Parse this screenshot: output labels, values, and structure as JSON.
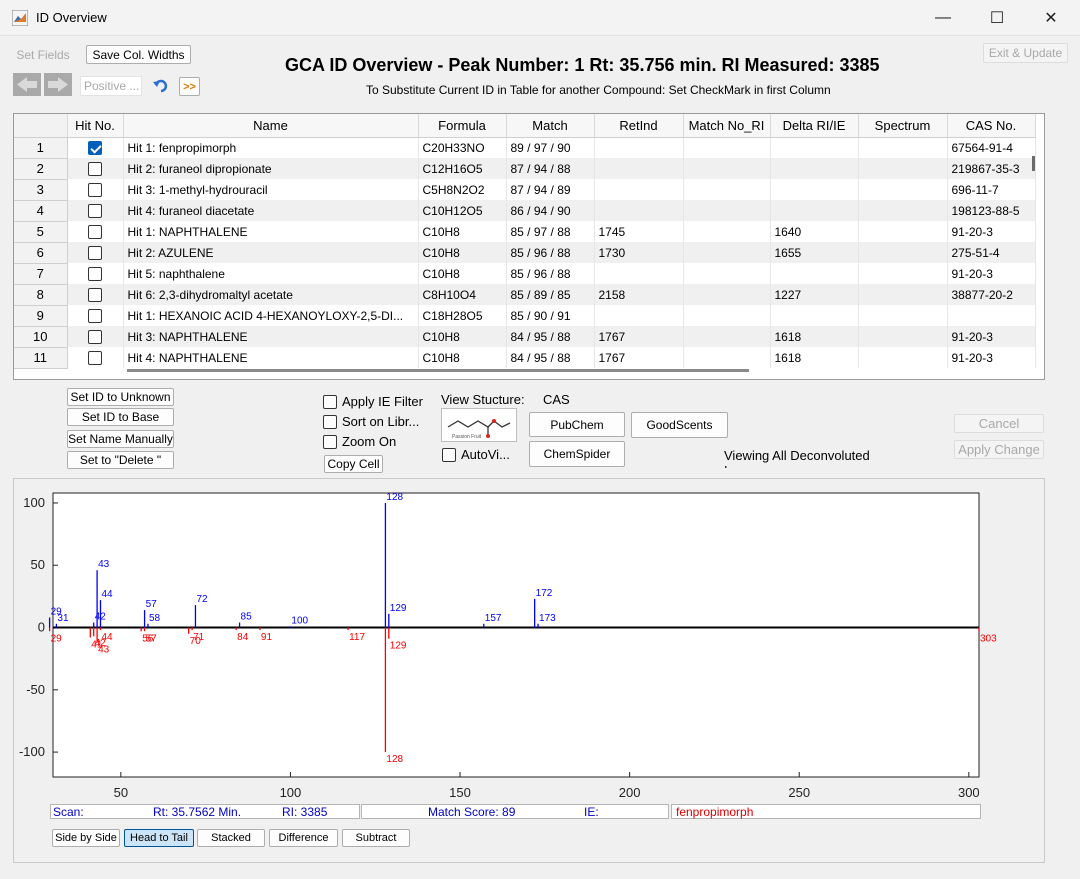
{
  "window": {
    "title": "ID Overview",
    "minimize": "—",
    "maximize": "☐",
    "close": "✕"
  },
  "toolbar": {
    "set_fields": "Set Fields",
    "save_col_widths": "Save Col. Widths",
    "mode_field": "Positive ...",
    "forward_label": ">>",
    "exit_update": "Exit & Update"
  },
  "header": {
    "title": "GCA ID Overview - Peak Number: 1  Rt: 35.756 min.  RI Measured: 3385",
    "subtitle": "To Substitute Current ID in Table for another Compound: Set CheckMark in first Column"
  },
  "table": {
    "columns": [
      "",
      "Hit No.",
      "Name",
      "Formula",
      "Match",
      "RetInd",
      "Match No_RI",
      "Delta RI/IE",
      "Spectrum",
      "CAS No."
    ],
    "rows": [
      {
        "num": "1",
        "checked": true,
        "name": "Hit  1: fenpropimorph",
        "formula": "C20H33NO",
        "match": "89 / 97 / 90",
        "retind": "",
        "matchnori": "",
        "delta": "",
        "spectrum": "",
        "cas": "67564-91-4"
      },
      {
        "num": "2",
        "checked": false,
        "name": "Hit  2: furaneol dipropionate",
        "formula": "C12H16O5",
        "match": "87 / 94 / 88",
        "retind": "",
        "matchnori": "",
        "delta": "",
        "spectrum": "",
        "cas": "219867-35-3"
      },
      {
        "num": "3",
        "checked": false,
        "name": "Hit  3: 1-methyl-hydrouracil",
        "formula": "C5H8N2O2",
        "match": "87 / 94 / 89",
        "retind": "",
        "matchnori": "",
        "delta": "",
        "spectrum": "",
        "cas": "696-11-7"
      },
      {
        "num": "4",
        "checked": false,
        "name": "Hit  4: furaneol diacetate",
        "formula": "C10H12O5",
        "match": "86 / 94 / 90",
        "retind": "",
        "matchnori": "",
        "delta": "",
        "spectrum": "",
        "cas": "198123-88-5"
      },
      {
        "num": "5",
        "checked": false,
        "name": "Hit  1: NAPHTHALENE",
        "formula": "C10H8",
        "match": "85 / 97 / 88",
        "retind": "1745",
        "matchnori": "",
        "delta": "1640",
        "spectrum": "",
        "cas": "91-20-3"
      },
      {
        "num": "6",
        "checked": false,
        "name": "Hit  2: AZULENE",
        "formula": "C10H8",
        "match": "85 / 96 / 88",
        "retind": "1730",
        "matchnori": "",
        "delta": "1655",
        "spectrum": "",
        "cas": "275-51-4"
      },
      {
        "num": "7",
        "checked": false,
        "name": "Hit  5: naphthalene",
        "formula": "C10H8",
        "match": "85 / 96 / 88",
        "retind": "",
        "matchnori": "",
        "delta": "",
        "spectrum": "",
        "cas": "91-20-3"
      },
      {
        "num": "8",
        "checked": false,
        "name": "Hit  6: 2,3-dihydromaltyl acetate",
        "formula": "C8H10O4",
        "match": "85 / 89 / 85",
        "retind": "2158",
        "matchnori": "",
        "delta": "1227",
        "spectrum": "",
        "cas": "38877-20-2"
      },
      {
        "num": "9",
        "checked": false,
        "name": "Hit  1: HEXANOIC ACID 4-HEXANOYLOXY-2,5-DI...",
        "formula": "C18H28O5",
        "match": "85 / 90 / 91",
        "retind": "",
        "matchnori": "",
        "delta": "",
        "spectrum": "",
        "cas": ""
      },
      {
        "num": "10",
        "checked": false,
        "name": "Hit  3: NAPHTHALENE",
        "formula": "C10H8",
        "match": "84 / 95 / 88",
        "retind": "1767",
        "matchnori": "",
        "delta": "1618",
        "spectrum": "",
        "cas": "91-20-3"
      },
      {
        "num": "11",
        "checked": false,
        "name": "Hit  4: NAPHTHALENE",
        "formula": "C10H8",
        "match": "84 / 95 / 88",
        "retind": "1767",
        "matchnori": "",
        "delta": "1618",
        "spectrum": "",
        "cas": "91-20-3"
      }
    ]
  },
  "actions": {
    "set_unknown": "Set ID to Unknown",
    "set_base": "Set ID to Base",
    "set_name_manually": "Set Name Manually",
    "set_delete": "Set to \"Delete \""
  },
  "options": {
    "apply_ie_filter": "Apply IE Filter",
    "sort_on_library": "Sort on Libr...",
    "zoom_on": "Zoom On",
    "copy_cell": "Copy Cell",
    "auto_view": "AutoVi..."
  },
  "structure": {
    "label": "View Stucture:",
    "cas_label": "CAS",
    "thumb_caption": "Passion Fruit",
    "pubchem": "PubChem",
    "goodscents": "GoodScents",
    "chemspider": "ChemSpider",
    "viewing_note": "Viewing All Deconvoluted Ions"
  },
  "side_buttons": {
    "cancel": "Cancel",
    "apply_change": "Apply Change"
  },
  "chart_data": {
    "type": "bar",
    "title": "",
    "xlabel": "",
    "ylabel": "",
    "xlim": [
      30,
      303
    ],
    "ylim": [
      -120,
      108
    ],
    "xticks": [
      50,
      100,
      150,
      200,
      250,
      300
    ],
    "yticks": [
      -100,
      -50,
      0,
      50,
      100
    ],
    "series": [
      {
        "name": "Measured",
        "color": "#0000ff",
        "peaks": [
          {
            "x": 29,
            "y": 8,
            "label": "29"
          },
          {
            "x": 31,
            "y": 3,
            "label": "31"
          },
          {
            "x": 42,
            "y": 4,
            "label": "42"
          },
          {
            "x": 43,
            "y": 46,
            "label": "43"
          },
          {
            "x": 44,
            "y": 22,
            "label": "44"
          },
          {
            "x": 57,
            "y": 14,
            "label": "57"
          },
          {
            "x": 58,
            "y": 3,
            "label": "58"
          },
          {
            "x": 72,
            "y": 18,
            "label": "72"
          },
          {
            "x": 85,
            "y": 4,
            "label": "85"
          },
          {
            "x": 100,
            "y": 1,
            "label": "100"
          },
          {
            "x": 128,
            "y": 100,
            "label": "128"
          },
          {
            "x": 129,
            "y": 11,
            "label": "129"
          },
          {
            "x": 157,
            "y": 3,
            "label": "157"
          },
          {
            "x": 172,
            "y": 23,
            "label": "172"
          },
          {
            "x": 173,
            "y": 3,
            "label": "173"
          }
        ]
      },
      {
        "name": "Library",
        "color": "#ff0000",
        "peaks": [
          {
            "x": 29,
            "y": -3,
            "label": "29"
          },
          {
            "x": 41,
            "y": -8,
            "label": "41"
          },
          {
            "x": 42,
            "y": -7,
            "label": "42"
          },
          {
            "x": 43,
            "y": -12,
            "label": "43"
          },
          {
            "x": 44,
            "y": -2,
            "label": "44"
          },
          {
            "x": 56,
            "y": -3,
            "label": "56"
          },
          {
            "x": 57,
            "y": -3,
            "label": "57"
          },
          {
            "x": 70,
            "y": -5,
            "label": "70"
          },
          {
            "x": 71,
            "y": -2,
            "label": "71"
          },
          {
            "x": 84,
            "y": -2,
            "label": "84"
          },
          {
            "x": 91,
            "y": -2,
            "label": "91"
          },
          {
            "x": 117,
            "y": -2,
            "label": "117"
          },
          {
            "x": 128,
            "y": -100,
            "label": "128"
          },
          {
            "x": 129,
            "y": -9,
            "label": "129"
          },
          {
            "x": 303,
            "y": -3,
            "label": "303"
          }
        ]
      }
    ]
  },
  "status": {
    "scan": "Scan:",
    "rt": "Rt: 35.7562 Min.",
    "ri": "RI: 3385",
    "match_score": "Match Score: 89",
    "ie": "IE:",
    "compound": "fenpropimorph"
  },
  "view_buttons": {
    "side_by_side": "Side by Side",
    "head_to_tail": "Head to Tail",
    "stacked": "Stacked",
    "difference": "Difference",
    "subtract": "Subtract"
  }
}
